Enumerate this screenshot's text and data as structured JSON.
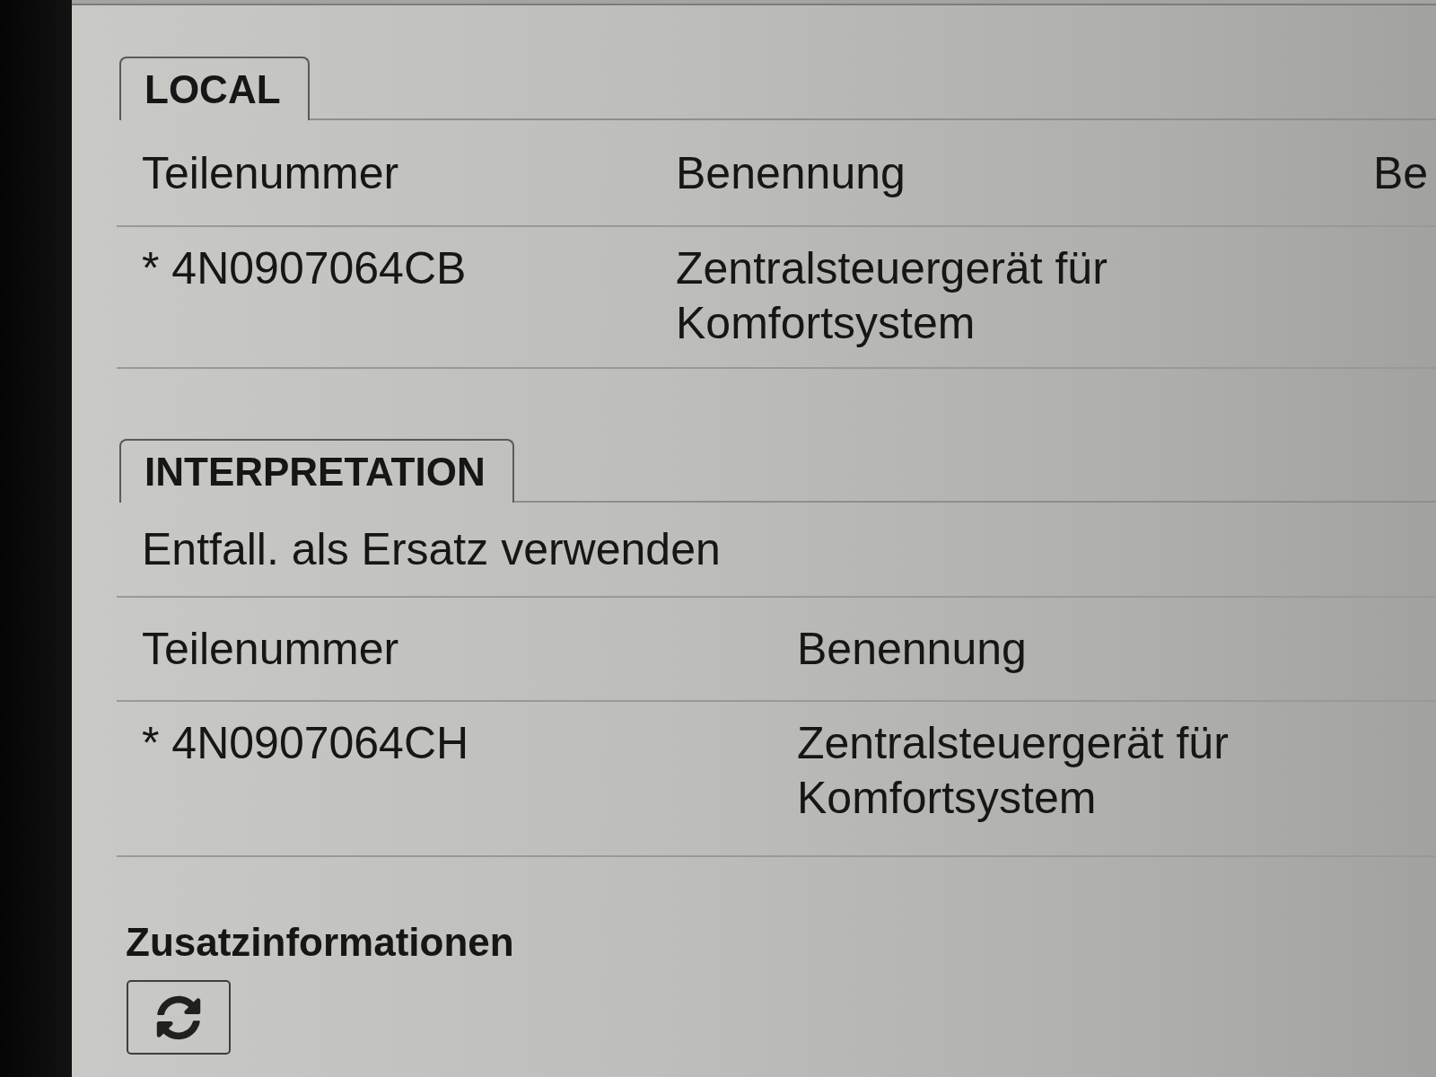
{
  "sections": [
    {
      "tab": "LOCAL",
      "columns": [
        "Teilenummer",
        "Benennung",
        "Be"
      ],
      "rows": [
        {
          "part_number": "* 4N0907064CB",
          "name": "Zentralsteuergerät für Komfortsystem"
        }
      ]
    },
    {
      "tab": "INTERPRETATION",
      "subtitle": "Entfall. als Ersatz verwenden",
      "columns": [
        "Teilenummer",
        "Benennung"
      ],
      "rows": [
        {
          "part_number": "* 4N0907064CH",
          "name": "Zentralsteuergerät für Komfortsystem"
        }
      ]
    }
  ],
  "additional_info": {
    "title": "Zusatzinformationen"
  }
}
